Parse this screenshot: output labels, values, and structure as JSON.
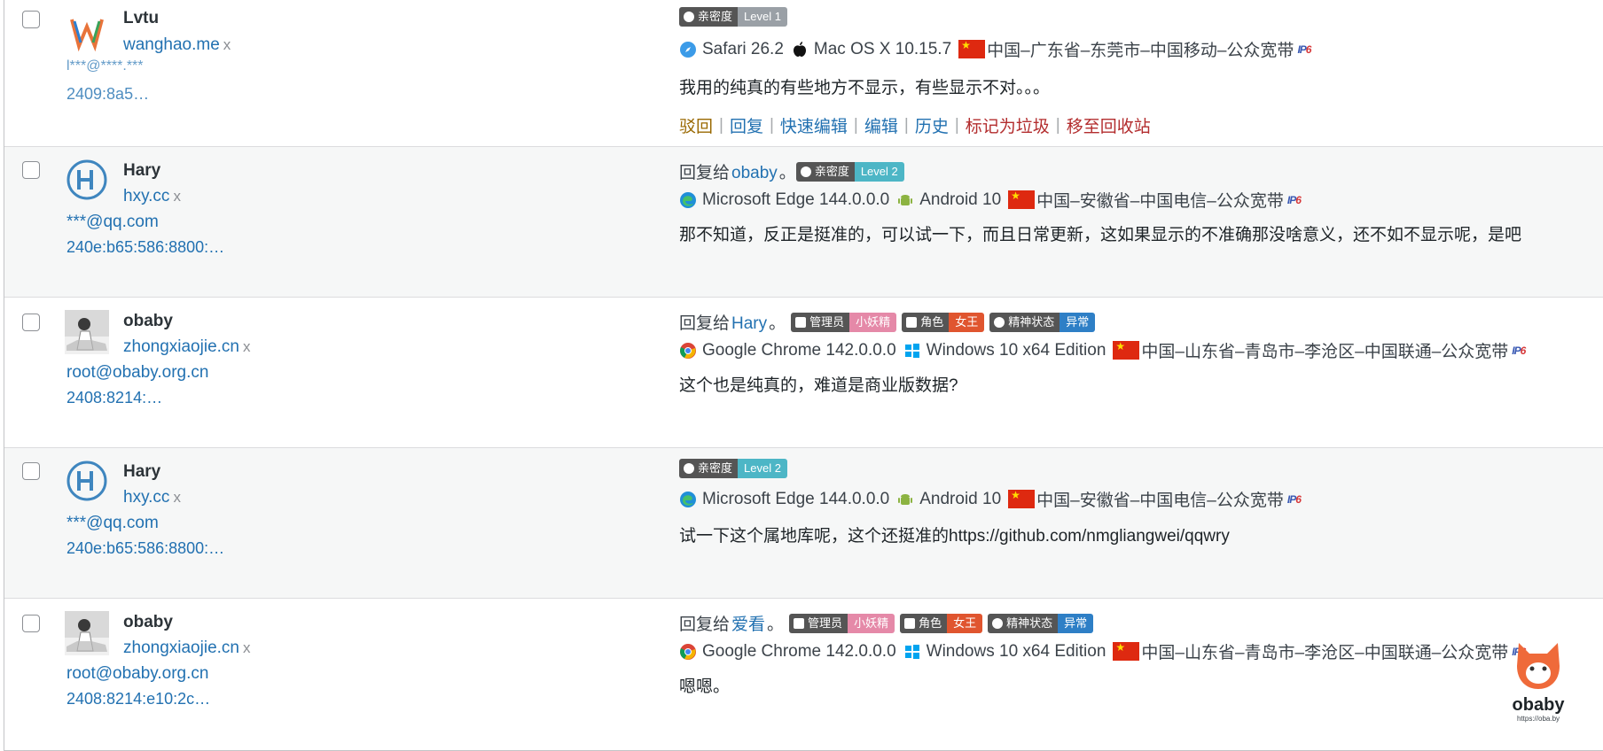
{
  "comments": [
    {
      "author": "Lvtu",
      "site": "wanghao.me",
      "site_x": "x",
      "email": "l***@****.***",
      "ip": "2409:8a5…",
      "reply_to": null,
      "badges": [
        {
          "label": "亲密度",
          "value": "Level 1",
          "color": "#9aa0a6"
        }
      ],
      "browser": "Safari 26.2",
      "os": "Mac OS X 10.15.7",
      "location": "中国–广东省–东莞市–中国移动–公众宽带",
      "text": "我用的纯真的有些地方不显示，有些显示不对。。。",
      "actions": [
        "驳回",
        "回复",
        "快速编辑",
        "编辑",
        "历史",
        "标记为垃圾",
        "移至回收站"
      ]
    },
    {
      "author": "Hary",
      "site": "hxy.cc",
      "site_x": "x",
      "email": "***@qq.com",
      "ip": "240e:b65:586:8800:…",
      "reply_prefix": "回复给",
      "reply_to": "obaby",
      "reply_suffix": "。",
      "badges": [
        {
          "label": "亲密度",
          "value": "Level 2",
          "color": "#4db6c6"
        }
      ],
      "browser": "Microsoft Edge 144.0.0.0",
      "os": "Android 10",
      "location": "中国–安徽省–中国电信–公众宽带",
      "text": "那不知道，反正是挺准的，可以试一下，而且日常更新，这如果显示的不准确那没啥意义，还不如不显示呢，是吧"
    },
    {
      "author": "obaby",
      "site": "zhongxiaojie.cn",
      "site_x": "x",
      "email": "root@obaby.org.cn",
      "ip": "2408:8214:…",
      "reply_prefix": "回复给",
      "reply_to": "Hary",
      "reply_suffix": "。",
      "badges": [
        {
          "label": "管理员",
          "value": "小妖精",
          "color": "#e589a8"
        },
        {
          "label": "角色",
          "value": "女王",
          "color": "#e0552f"
        },
        {
          "label": "精神状态",
          "value": "异常",
          "color": "#2e7fc6"
        }
      ],
      "browser": "Google Chrome 142.0.0.0",
      "os": "Windows 10 x64 Edition",
      "location": "中国–山东省–青岛市–李沧区–中国联通–公众宽带",
      "text": "这个也是纯真的，难道是商业版数据?"
    },
    {
      "author": "Hary",
      "site": "hxy.cc",
      "site_x": "x",
      "email": "***@qq.com",
      "ip": "240e:b65:586:8800:…",
      "reply_to": null,
      "badges": [
        {
          "label": "亲密度",
          "value": "Level 2",
          "color": "#4db6c6"
        }
      ],
      "browser": "Microsoft Edge 144.0.0.0",
      "os": "Android 10",
      "location": "中国–安徽省–中国电信–公众宽带",
      "text": "试一下这个属地库呢，这个还挺准的https://github.com/nmgliangwei/qqwry"
    },
    {
      "author": "obaby",
      "site": "zhongxiaojie.cn",
      "site_x": "x",
      "email": "root@obaby.org.cn",
      "ip": "2408:8214:e10:2c…",
      "reply_prefix": "回复给",
      "reply_to": "爱看",
      "reply_suffix": "。",
      "badges": [
        {
          "label": "管理员",
          "value": "小妖精",
          "color": "#e589a8"
        },
        {
          "label": "角色",
          "value": "女王",
          "color": "#e0552f"
        },
        {
          "label": "精神状态",
          "value": "异常",
          "color": "#2e7fc6"
        }
      ],
      "browser": "Google Chrome 142.0.0.0",
      "os": "Windows 10 x64 Edition",
      "location": "中国–山东省–青岛市–李沧区–中国联通–公众宽带",
      "text": "嗯嗯。"
    }
  ],
  "action_colors": {
    "驳回": "#996800",
    "回复": "#2271b1",
    "快速编辑": "#2271b1",
    "编辑": "#2271b1",
    "历史": "#2271b1",
    "标记为垃圾": "#b32d2e",
    "移至回收站": "#b32d2e"
  },
  "ipv6_label": "IPv6",
  "watermark": {
    "brand": "obaby",
    "url": "https://oba.by"
  }
}
